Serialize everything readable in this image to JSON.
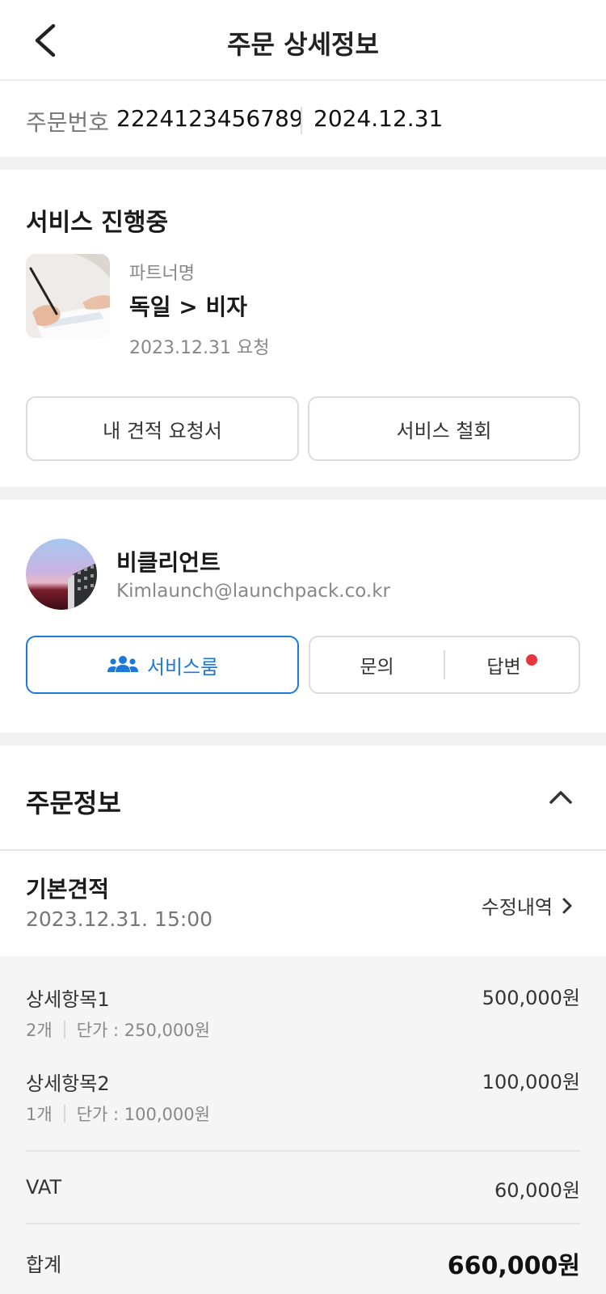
{
  "header": {
    "title": "주문 상세정보",
    "back_icon": "chevron-left-icon"
  },
  "order": {
    "number_label": "주문번호",
    "number": "2224123456789",
    "date": "2024.12.31"
  },
  "service": {
    "status_title": "서비스 진행중",
    "partner_label": "파트너명",
    "partner_name": "독일 > 비자",
    "request_date": "2023.12.31 요청",
    "quote_button": "내 견적 요청서",
    "withdraw_button": "서비스 철회"
  },
  "client": {
    "name": "비클리언트",
    "email": "Kimlaunch@launchpack.co.kr",
    "service_room_button": "서비스룸",
    "inquiry_button": "문의",
    "answer_button": "답변",
    "accent_color": "#1e78d6",
    "notification_color": "#e8353d"
  },
  "order_info": {
    "title": "주문정보",
    "base_quote_title": "기본견적",
    "base_quote_date": "2023.12.31. 15:00",
    "history_link": "수정내역",
    "items": [
      {
        "name": "상세항목1",
        "qty": "2개",
        "unit_price": "단가 : 250,000원",
        "price": "500,000원"
      },
      {
        "name": "상세항목2",
        "qty": "1개",
        "unit_price": "단가 : 100,000원",
        "price": "100,000원"
      }
    ],
    "vat_label": "VAT",
    "vat_value": "60,000원",
    "total_label": "합계",
    "total_value": "660,000원"
  }
}
